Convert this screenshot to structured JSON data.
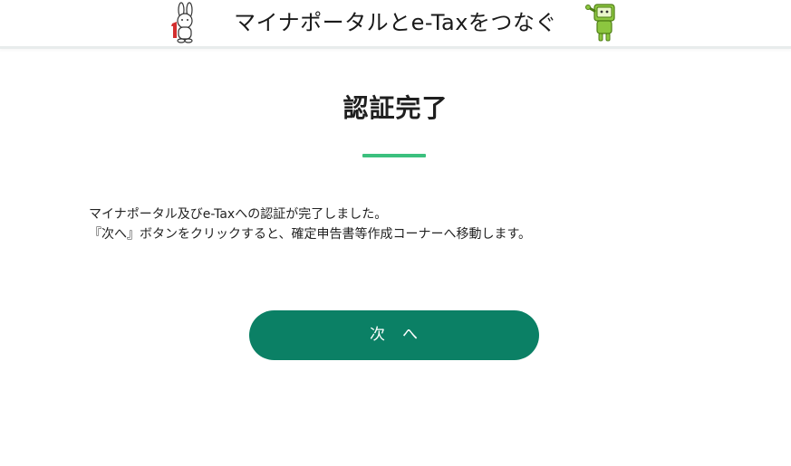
{
  "header": {
    "title": "マイナポータルとe-Taxをつなぐ",
    "left_mascot_icon": "rabbit-mascot-icon",
    "right_mascot_icon": "etax-robot-mascot-icon"
  },
  "main": {
    "title": "認証完了",
    "message_lines": [
      "マイナポータル及びe-Taxへの認証が完了しました。",
      "『次へ』ボタンをクリックすると、確定申告書等作成コーナーへ移動します。"
    ],
    "next_button_label": "次　へ"
  },
  "colors": {
    "accent_rule": "#3cc07e",
    "button": "#0b8065",
    "mascot_left_red": "#d32f2f",
    "mascot_right_green": "#8cc63f"
  }
}
